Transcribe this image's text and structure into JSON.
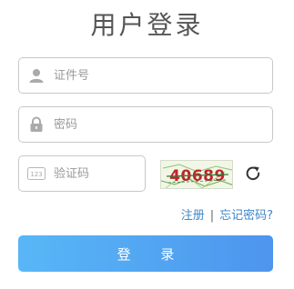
{
  "page": {
    "title": "用户登录"
  },
  "form": {
    "id_placeholder": "证件号",
    "password_placeholder": "密码",
    "captcha_placeholder": "验证码",
    "captcha_text": "40689",
    "captcha_badge": "123"
  },
  "links": {
    "register": "注册",
    "separator": "|",
    "forgot": "忘记密码?"
  },
  "actions": {
    "login_label": "登 录"
  },
  "icons": {
    "id_field": "user-icon",
    "password_field": "lock-icon",
    "captcha_field": "keypad-icon",
    "captcha_refresh": "refresh-icon"
  },
  "colors": {
    "button_start": "#58b7f6",
    "button_end": "#4d95ee",
    "link": "#3f86c8"
  }
}
